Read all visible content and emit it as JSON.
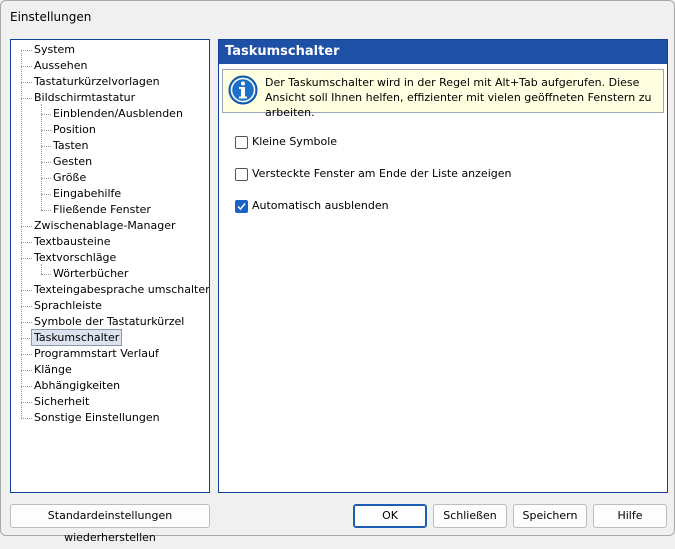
{
  "window": {
    "title": "Einstellungen"
  },
  "tree": {
    "items": [
      {
        "label": "System",
        "level": 0
      },
      {
        "label": "Aussehen",
        "level": 0
      },
      {
        "label": "Tastaturkürzelvorlagen",
        "level": 0
      },
      {
        "label": "Bildschirmtastatur",
        "level": 0
      },
      {
        "label": "Einblenden/Ausblenden",
        "level": 1
      },
      {
        "label": "Position",
        "level": 1
      },
      {
        "label": "Tasten",
        "level": 1
      },
      {
        "label": "Gesten",
        "level": 1
      },
      {
        "label": "Größe",
        "level": 1
      },
      {
        "label": "Eingabehilfe",
        "level": 1
      },
      {
        "label": "Fließende Fenster",
        "level": 1
      },
      {
        "label": "Zwischenablage-Manager",
        "level": 0
      },
      {
        "label": "Textbausteine",
        "level": 0
      },
      {
        "label": "Textvorschläge",
        "level": 0
      },
      {
        "label": "Wörterbücher",
        "level": 1
      },
      {
        "label": "Texteingabesprache umschalten",
        "level": 0
      },
      {
        "label": "Sprachleiste",
        "level": 0
      },
      {
        "label": "Symbole der Tastaturkürzel",
        "level": 0
      },
      {
        "label": "Taskumschalter",
        "level": 0,
        "selected": true
      },
      {
        "label": "Programmstart Verlauf",
        "level": 0
      },
      {
        "label": "Klänge",
        "level": 0
      },
      {
        "label": "Abhängigkeiten",
        "level": 0
      },
      {
        "label": "Sicherheit",
        "level": 0
      },
      {
        "label": "Sonstige Einstellungen",
        "level": 0
      }
    ]
  },
  "panel": {
    "title": "Taskumschalter",
    "info_text": "Der Taskumschalter wird in der Regel mit Alt+Tab aufgerufen. Diese Ansicht soll Ihnen helfen, effizienter mit vielen geöffneten Fenstern zu arbeiten.",
    "info_icon": "info-icon",
    "options": [
      {
        "label": "Kleine Symbole",
        "checked": false
      },
      {
        "label": "Versteckte Fenster am Ende der Liste anzeigen",
        "checked": false
      },
      {
        "label": "Automatisch ausblenden",
        "checked": true
      }
    ]
  },
  "buttons": {
    "reset": "Standardeinstellungen wiederherstellen",
    "ok": "OK",
    "close": "Schließen",
    "save": "Speichern",
    "help": "Hilfe"
  },
  "colors": {
    "header_bg": "#1e50a6",
    "checkbox_checked": "#1a63c6",
    "info_bg": "#ffffe1"
  }
}
